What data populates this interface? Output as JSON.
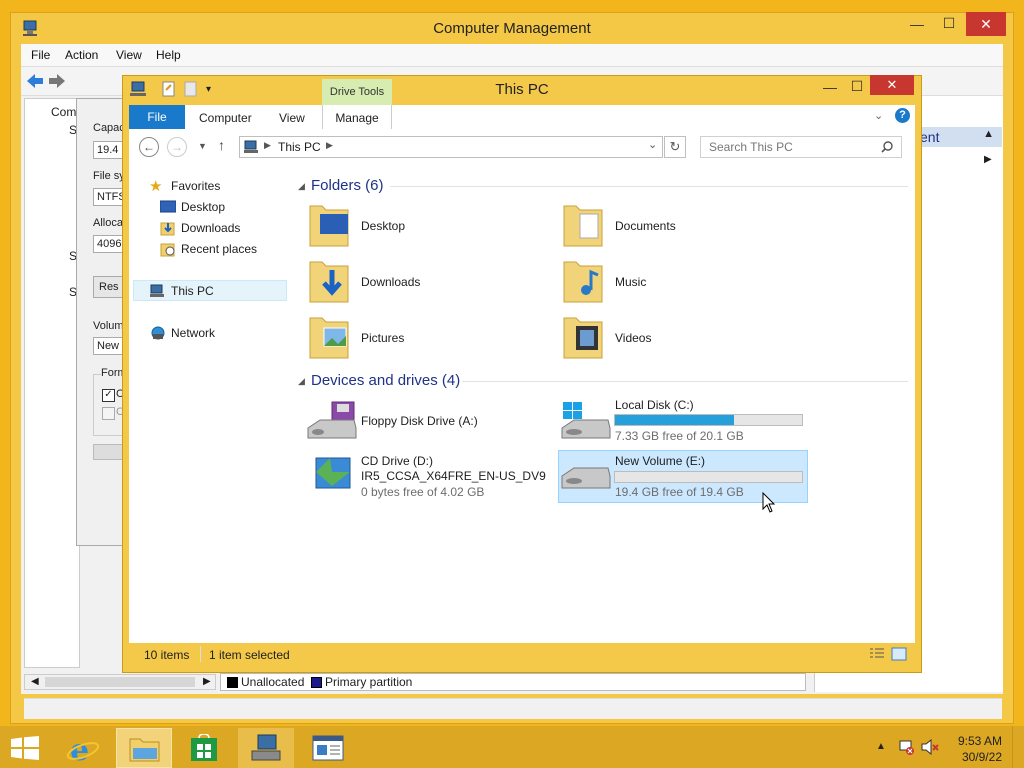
{
  "computer_management": {
    "title": "Computer Management",
    "menu": [
      "File",
      "Action",
      "View",
      "Help"
    ],
    "tree_fragments": [
      "Com",
      "S",
      "S",
      "S"
    ],
    "actions_header_fragment": "ent",
    "legend": {
      "unallocated": "Unallocated",
      "primary": "Primary partition"
    }
  },
  "dialog": {
    "capacity_label": "Capac",
    "capacity_value": "19.4",
    "filesystem_label": "File sy",
    "filesystem_value": "NTFS",
    "alloc_label": "Alloca",
    "alloc_value": "4096",
    "restore_button": "Res",
    "volume_label": "Volum",
    "volume_value": "New",
    "format_label": "Form",
    "opt1": "C",
    "opt2": "C"
  },
  "explorer": {
    "title": "This PC",
    "contextual_tab": "Drive Tools",
    "tabs": {
      "file": "File",
      "computer": "Computer",
      "view": "View",
      "manage": "Manage"
    },
    "address": "This PC",
    "search_placeholder": "Search This PC",
    "nav": {
      "favorites": "Favorites",
      "desktop": "Desktop",
      "downloads": "Downloads",
      "recent": "Recent places",
      "thispc": "This PC",
      "network": "Network"
    },
    "folders_header": "Folders (6)",
    "folders": [
      "Desktop",
      "Documents",
      "Downloads",
      "Music",
      "Pictures",
      "Videos"
    ],
    "devices_header": "Devices and drives (4)",
    "drives": {
      "floppy": {
        "name": "Floppy Disk Drive (A:)"
      },
      "c": {
        "name": "Local Disk (C:)",
        "free": "7.33 GB free of 20.1 GB",
        "used_fraction": 0.635
      },
      "d": {
        "name": "CD Drive (D:)",
        "label": "IR5_CCSA_X64FRE_EN-US_DV9",
        "free": "0 bytes free of 4.02 GB"
      },
      "e": {
        "name": "New Volume (E:)",
        "free": "19.4 GB free of 19.4 GB",
        "used_fraction": 0.0
      }
    },
    "status": {
      "items": "10 items",
      "selected": "1 item selected"
    }
  },
  "taskbar": {
    "time": "9:53 AM",
    "date": "30/9/22"
  },
  "colors": {
    "accent": "#1979ca",
    "title_bar": "#f4c94a",
    "desktop": "#f2b61c",
    "bar_fill": "#26a0da"
  }
}
